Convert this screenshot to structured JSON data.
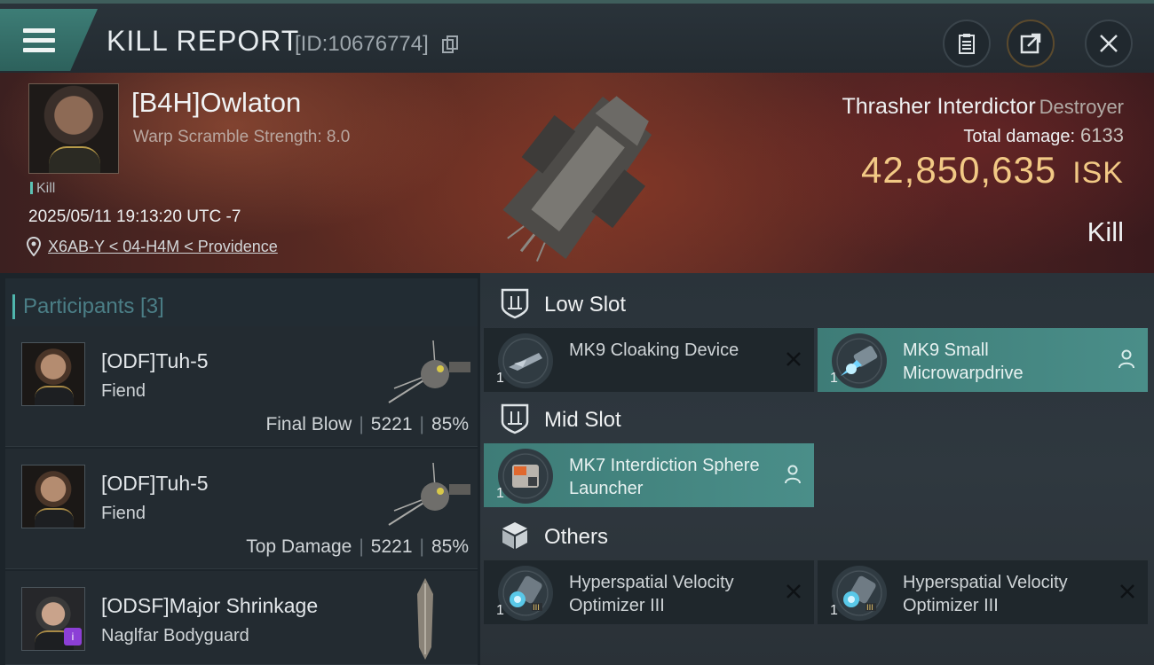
{
  "header": {
    "title": "KILL REPORT",
    "report_id": "[ID:10676774]"
  },
  "victim": {
    "name": "[B4H]Owlaton",
    "attribute": "Warp Scramble Strength: 8.0",
    "tag": "Kill",
    "timestamp": "2025/05/11 19:13:20 UTC -7",
    "location": "X6AB-Y < 04-H4M < Providence",
    "ship_name": "Thrasher Interdictor",
    "ship_class": "Destroyer",
    "damage_label": "Total damage:",
    "damage_value": "6133",
    "isk_value": "42,850,635",
    "isk_unit": "ISK",
    "result": "Kill"
  },
  "participants": {
    "label": "Participants [3]",
    "rows": [
      {
        "name": "[ODF]Tuh-5",
        "ship": "Fiend",
        "role": "Final Blow",
        "damage": "5221",
        "percent": "85%"
      },
      {
        "name": "[ODF]Tuh-5",
        "ship": "Fiend",
        "role": "Top Damage",
        "damage": "5221",
        "percent": "85%"
      },
      {
        "name": "[ODSF]Major Shrinkage",
        "ship": "Naglfar Bodyguard"
      }
    ]
  },
  "slots": {
    "low": {
      "label": "Low Slot",
      "items": [
        {
          "name": "MK9 Cloaking Device",
          "qty": "1"
        },
        {
          "name": "MK9 Small Microwarpdrive",
          "qty": "1"
        }
      ]
    },
    "mid": {
      "label": "Mid Slot",
      "items": [
        {
          "name": "MK7 Interdiction Sphere Launcher",
          "qty": "1"
        }
      ]
    },
    "others": {
      "label": "Others",
      "items": [
        {
          "name": "Hyperspatial Velocity Optimizer III",
          "qty": "1"
        },
        {
          "name": "Hyperspatial Velocity Optimizer III",
          "qty": "1"
        }
      ]
    }
  },
  "colors": {
    "accent": "#4fb6ad",
    "isk": "#f2c985",
    "active_item": "#468884"
  },
  "icons": [
    "menu-icon",
    "copy-icon",
    "clipboard-icon",
    "share-icon",
    "close-icon",
    "location-pin-icon",
    "shield-icon",
    "box-icon",
    "x-icon",
    "pilot-icon"
  ]
}
